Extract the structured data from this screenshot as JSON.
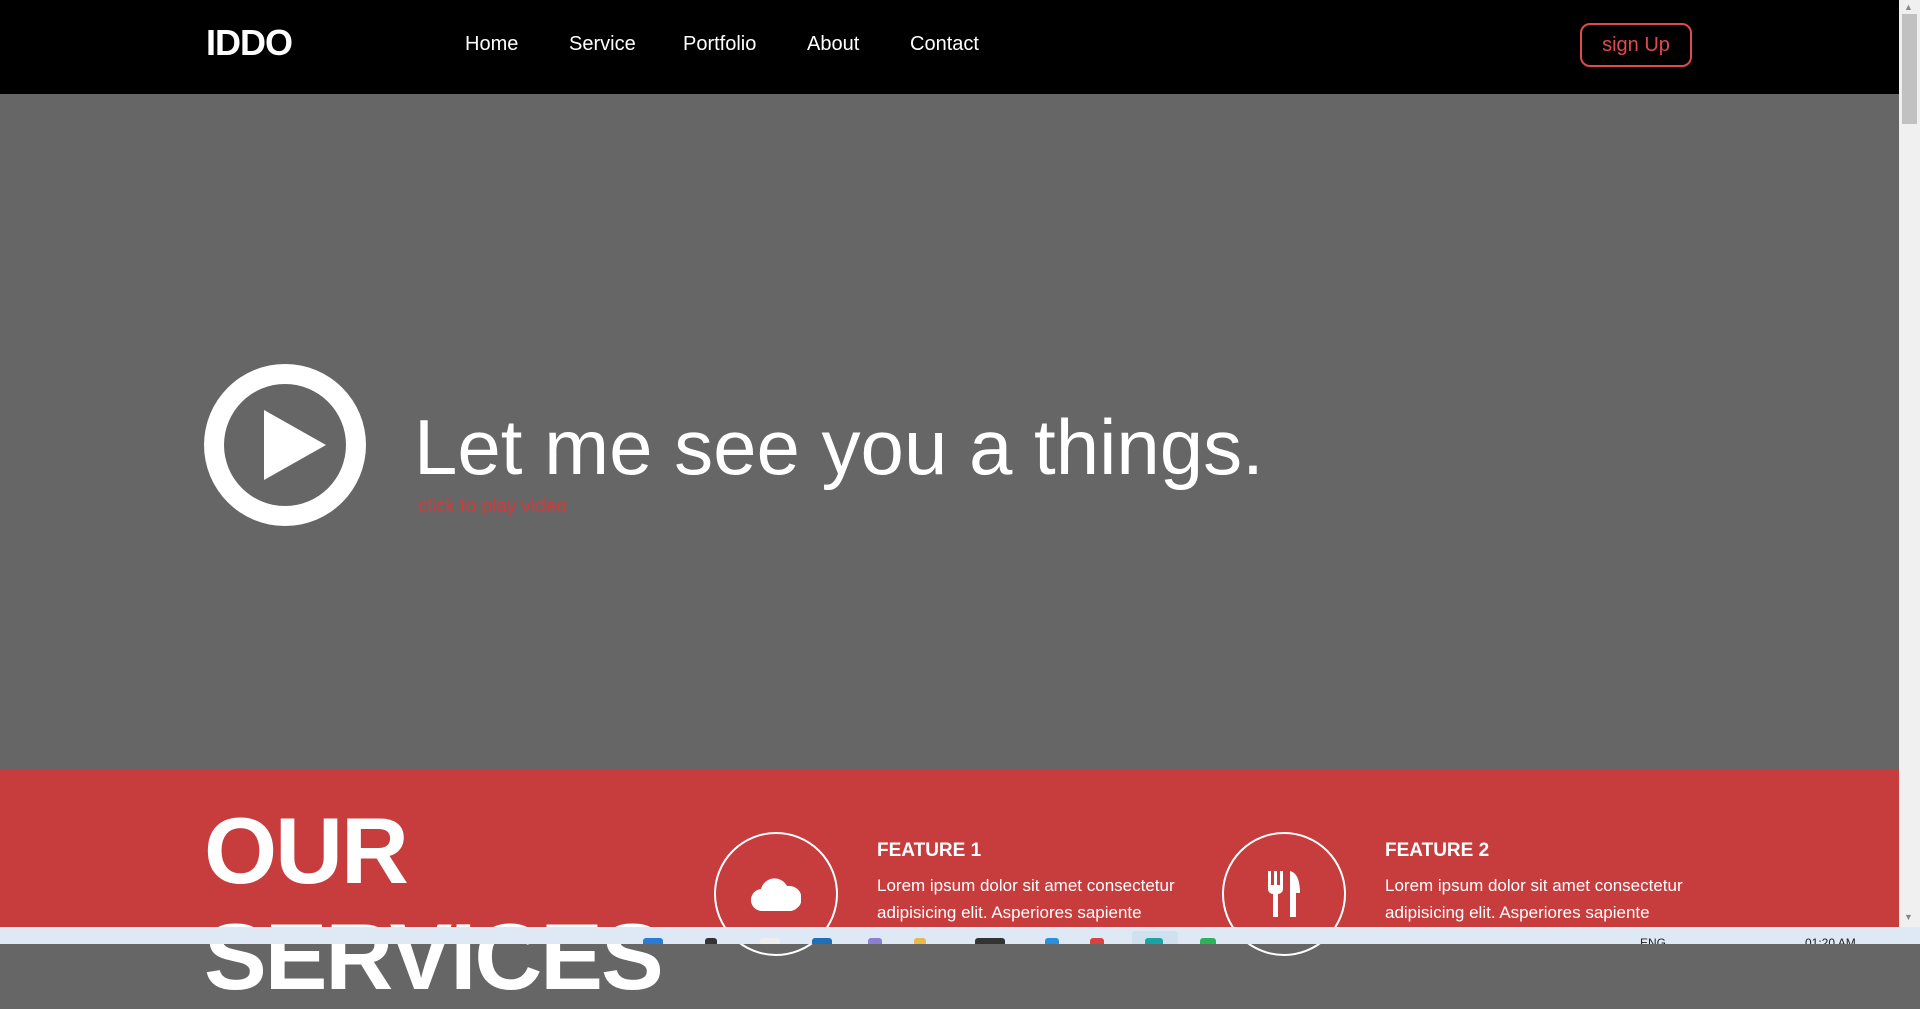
{
  "nav": {
    "logo": "IDDO",
    "links": [
      "Home",
      "Service",
      "Portfolio",
      "About",
      "Contact"
    ],
    "signup_label": "sign Up"
  },
  "hero": {
    "headline": "Let me see you a things.",
    "subtitle": "click to play video"
  },
  "services": {
    "title_line1": "OUR",
    "title_line2": "SERVICES",
    "features": [
      {
        "icon": "cloud-icon",
        "title": "FEATURE 1",
        "text": "Lorem ipsum dolor sit amet consectetur adipisicing elit. Asperiores sapiente"
      },
      {
        "icon": "fork-knife-icon",
        "title": "FEATURE 2",
        "text": "Lorem ipsum dolor sit amet consectetur adipisicing elit. Asperiores sapiente"
      }
    ]
  },
  "taskbar": {
    "language": "ENG",
    "time": "01:20 AM"
  },
  "colors": {
    "accent": "#c73c3c",
    "nav_bg": "#000000",
    "hero_bg": "#666666"
  }
}
